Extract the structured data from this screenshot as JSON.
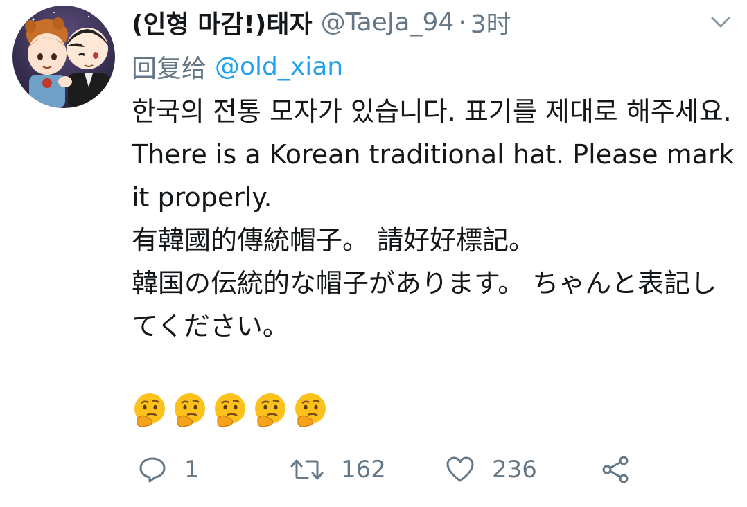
{
  "tweet": {
    "display_name": "(인형 마감!)태자",
    "handle": "@TaeJa_94",
    "separator": "·",
    "time": "3时",
    "reply_label": "回复给",
    "reply_to": "@old_xian",
    "body": [
      "한국의 전통 모자가 있습니다. 표기를 제대로 해주세요.",
      "There is a Korean traditional hat. Please mark it properly.",
      "有韓國的傳統帽子。 請好好標記。",
      "韓国の伝統的な帽子があります。 ちゃんと表記してください。"
    ],
    "emoji_icons": [
      "thinking-face-icon",
      "thinking-face-icon",
      "thinking-face-icon",
      "thinking-face-icon",
      "thinking-face-icon"
    ]
  },
  "actions": {
    "reply_count": "1",
    "retweet_count": "162",
    "like_count": "236"
  },
  "colors": {
    "text": "#14171a",
    "muted": "#657786",
    "link": "#1da1f2",
    "emoji_yellow": "#fcc21b"
  }
}
